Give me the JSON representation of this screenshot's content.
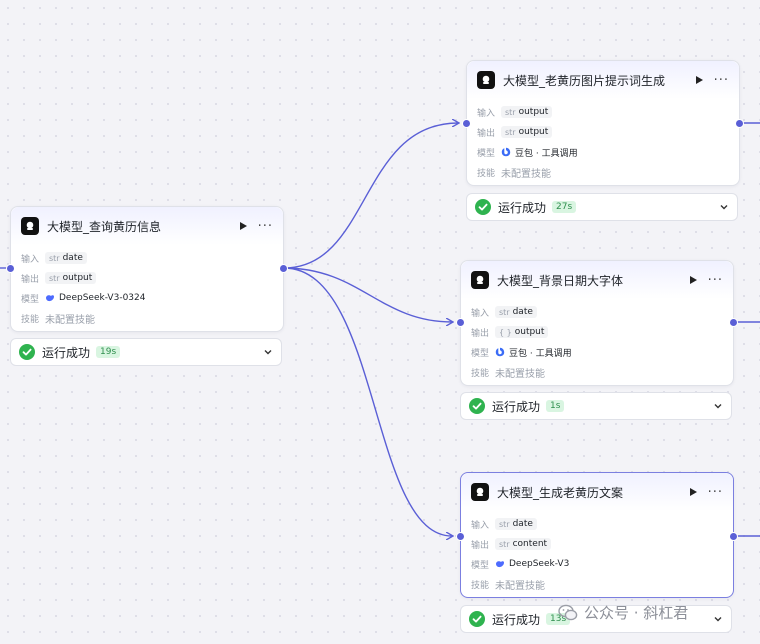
{
  "colors": {
    "accent": "#5a5fd6",
    "success": "#2fb34f",
    "edge": "#5a5fd6"
  },
  "nodes": [
    {
      "title": "大模型_查询黄历信息",
      "input_label": "输入",
      "input_type": "str",
      "input_value": "date",
      "output_label": "输出",
      "output_type": "str",
      "output_value": "output",
      "model_label": "模型",
      "model_icon": "deepseek-whale-icon",
      "model_value": "DeepSeek-V3-0324",
      "skill_label": "技能",
      "skill_value": "未配置技能",
      "status_text": "运行成功",
      "duration": "19s"
    },
    {
      "title": "大模型_老黄历图片提示词生成",
      "input_label": "输入",
      "input_type": "str",
      "input_value": "output",
      "output_label": "输出",
      "output_type": "str",
      "output_value": "output",
      "model_label": "模型",
      "model_icon": "doubao-icon",
      "model_value": "豆包 · 工具调用",
      "skill_label": "技能",
      "skill_value": "未配置技能",
      "status_text": "运行成功",
      "duration": "27s"
    },
    {
      "title": "大模型_背景日期大字体",
      "input_label": "输入",
      "input_type": "str",
      "input_value": "date",
      "output_label": "输出",
      "output_type": "{ }",
      "output_value": "output",
      "model_label": "模型",
      "model_icon": "doubao-icon",
      "model_value": "豆包 · 工具调用",
      "skill_label": "技能",
      "skill_value": "未配置技能",
      "status_text": "运行成功",
      "duration": "1s"
    },
    {
      "title": "大模型_生成老黄历文案",
      "input_label": "输入",
      "input_type": "str",
      "input_value": "date",
      "output_label": "输出",
      "output_type": "str",
      "output_value": "content",
      "model_label": "模型",
      "model_icon": "deepseek-whale-icon",
      "model_value": "DeepSeek-V3",
      "skill_label": "技能",
      "skill_value": "未配置技能",
      "status_text": "运行成功",
      "duration": "13s"
    }
  ],
  "watermark": {
    "text": "公众号 · 斜杠君",
    "icon": "wechat-icon"
  }
}
